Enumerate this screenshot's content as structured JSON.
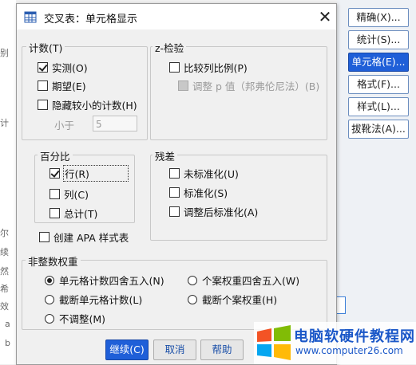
{
  "dialog": {
    "title": "交叉表：单元格显示",
    "close_glyph": "✕"
  },
  "counts": {
    "legend": "计数(T)",
    "observed": {
      "label": "实测(O)",
      "checked": true
    },
    "expected": {
      "label": "期望(E)",
      "checked": false
    },
    "hide_small": {
      "label": "隐藏较小的计数(H)",
      "checked": false
    },
    "less_than_label": "小于",
    "less_than_value": "5"
  },
  "ztest": {
    "legend": "z-检验",
    "compare_cols": {
      "label": "比较列比例(P)",
      "checked": false
    },
    "adjust_p": {
      "label": "调整 p 值（邦弗伦尼法）(B)",
      "checked": false,
      "disabled": true
    }
  },
  "percentages": {
    "legend": "百分比",
    "row": {
      "label": "行(R)",
      "checked": true
    },
    "column": {
      "label": "列(C)",
      "checked": false
    },
    "total": {
      "label": "总计(T)",
      "checked": false
    }
  },
  "apa": {
    "label": "创建 APA 样式表",
    "checked": false
  },
  "residuals": {
    "legend": "残差",
    "unstandardized": {
      "label": "未标准化(U)",
      "checked": false
    },
    "standardized": {
      "label": "标准化(S)",
      "checked": false
    },
    "adjusted": {
      "label": "调整后标准化(A)",
      "checked": false
    }
  },
  "noninteger": {
    "legend": "非整数权重",
    "options": [
      {
        "label": "单元格计数四舍五入(N)",
        "selected": true
      },
      {
        "label": "个案权重四舍五入(W)",
        "selected": false
      },
      {
        "label": "截断单元格计数(L)",
        "selected": false
      },
      {
        "label": "截断个案权重(H)",
        "selected": false
      },
      {
        "label": "不调整(M)",
        "selected": false
      }
    ]
  },
  "buttons": {
    "continue": "继续(C)",
    "cancel": "取消",
    "help": "帮助"
  },
  "side_panel": {
    "buttons": [
      {
        "label": "精确(X)...",
        "active": false
      },
      {
        "label": "统计(S)...",
        "active": false
      },
      {
        "label": "单元格(E)...",
        "active": true
      },
      {
        "label": "格式(F)...",
        "active": false
      },
      {
        "label": "样式(L)...",
        "active": false
      },
      {
        "label": "拔靴法(A)...",
        "active": false
      }
    ]
  },
  "background_fragments": [
    "别",
    "计",
    "尔",
    "续",
    "然",
    "希",
    "效",
    "a",
    "b"
  ],
  "watermark": {
    "name": "电脑软硬件教程网",
    "url": "www.computer26.com"
  },
  "colors": {
    "accent": "#1f5fd8",
    "watermark": "#1a57c8"
  }
}
